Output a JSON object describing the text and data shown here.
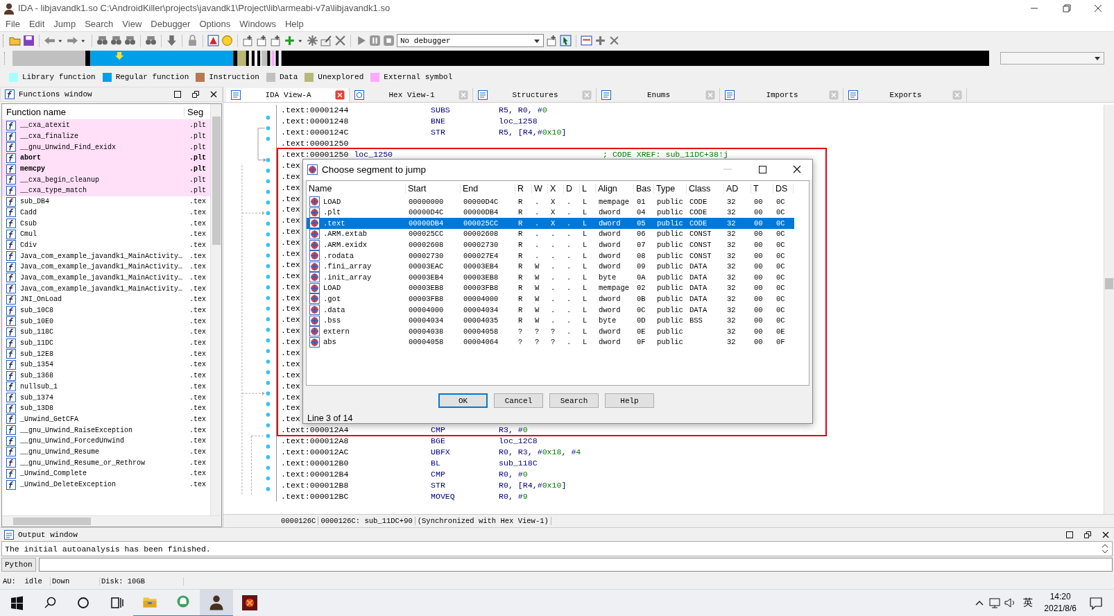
{
  "window": {
    "title": "IDA - libjavandk1.so C:\\AndroidKiller\\projects\\javandk1\\Project\\lib\\armeabi-v7a\\libjavandk1.so"
  },
  "menu": [
    "File",
    "Edit",
    "Jump",
    "Search",
    "View",
    "Debugger",
    "Options",
    "Windows",
    "Help"
  ],
  "toolbar": {
    "debugger_select": {
      "value": "No debugger"
    }
  },
  "legend": [
    {
      "label": "Library function",
      "color": "#a8ffff"
    },
    {
      "label": "Regular function",
      "color": "#00a0e8"
    },
    {
      "label": "Instruction",
      "color": "#b87850"
    },
    {
      "label": "Data",
      "color": "#c0c0c0"
    },
    {
      "label": "Unexplored",
      "color": "#b8b878"
    },
    {
      "label": "External symbol",
      "color": "#ffa8ff"
    }
  ],
  "functions_window": {
    "title": "Functions window",
    "columns": [
      "Function name",
      "Seg"
    ],
    "rows": [
      {
        "name": "__cxa_atexit",
        "segment": ".plt",
        "kind": "external",
        "bold": false
      },
      {
        "name": "__cxa_finalize",
        "segment": ".plt",
        "kind": "external",
        "bold": false
      },
      {
        "name": "__gnu_Unwind_Find_exidx",
        "segment": ".plt",
        "kind": "external",
        "bold": false
      },
      {
        "name": "abort",
        "segment": ".plt",
        "kind": "external",
        "bold": true
      },
      {
        "name": "memcpy",
        "segment": ".plt",
        "kind": "external",
        "bold": true
      },
      {
        "name": "__cxa_begin_cleanup",
        "segment": ".plt",
        "kind": "external",
        "bold": false
      },
      {
        "name": "__cxa_type_match",
        "segment": ".plt",
        "kind": "external",
        "bold": false
      },
      {
        "name": "sub_DB4",
        "segment": ".tex",
        "kind": "regular",
        "bold": false
      },
      {
        "name": "Cadd",
        "segment": ".tex",
        "kind": "regular",
        "bold": false
      },
      {
        "name": "Csub",
        "segment": ".tex",
        "kind": "regular",
        "bold": false
      },
      {
        "name": "Cmul",
        "segment": ".tex",
        "kind": "regular",
        "bold": false
      },
      {
        "name": "Cdiv",
        "segment": ".tex",
        "kind": "regular",
        "bold": false
      },
      {
        "name": "Java_com_example_javandk1_MainActivity…",
        "segment": ".tex",
        "kind": "regular",
        "bold": false
      },
      {
        "name": "Java_com_example_javandk1_MainActivity…",
        "segment": ".tex",
        "kind": "regular",
        "bold": false
      },
      {
        "name": "Java_com_example_javandk1_MainActivity…",
        "segment": ".tex",
        "kind": "regular",
        "bold": false
      },
      {
        "name": "Java_com_example_javandk1_MainActivity…",
        "segment": ".tex",
        "kind": "regular",
        "bold": false
      },
      {
        "name": "JNI_OnLoad",
        "segment": ".tex",
        "kind": "regular",
        "bold": false
      },
      {
        "name": "sub_10C8",
        "segment": ".tex",
        "kind": "regular",
        "bold": false
      },
      {
        "name": "sub_10E0",
        "segment": ".tex",
        "kind": "regular",
        "bold": false
      },
      {
        "name": "sub_118C",
        "segment": ".tex",
        "kind": "regular",
        "bold": false
      },
      {
        "name": "sub_11DC",
        "segment": ".tex",
        "kind": "regular",
        "bold": false
      },
      {
        "name": "sub_12E8",
        "segment": ".tex",
        "kind": "regular",
        "bold": false
      },
      {
        "name": "sub_1354",
        "segment": ".tex",
        "kind": "regular",
        "bold": false
      },
      {
        "name": "sub_1368",
        "segment": ".tex",
        "kind": "regular",
        "bold": false
      },
      {
        "name": "nullsub_1",
        "segment": ".tex",
        "kind": "regular",
        "bold": false
      },
      {
        "name": "sub_1374",
        "segment": ".tex",
        "kind": "regular",
        "bold": false
      },
      {
        "name": "sub_13D8",
        "segment": ".tex",
        "kind": "regular",
        "bold": false
      },
      {
        "name": "_Unwind_GetCFA",
        "segment": ".tex",
        "kind": "regular",
        "bold": false
      },
      {
        "name": "__gnu_Unwind_RaiseException",
        "segment": ".tex",
        "kind": "regular",
        "bold": false
      },
      {
        "name": "__gnu_Unwind_ForcedUnwind",
        "segment": ".tex",
        "kind": "regular",
        "bold": false
      },
      {
        "name": "__gnu_Unwind_Resume",
        "segment": ".tex",
        "kind": "regular",
        "bold": false
      },
      {
        "name": "__gnu_Unwind_Resume_or_Rethrow",
        "segment": ".tex",
        "kind": "regular",
        "bold": false
      },
      {
        "name": "_Unwind_Complete",
        "segment": ".tex",
        "kind": "regular",
        "bold": false
      },
      {
        "name": "_Unwind_DeleteException",
        "segment": ".tex",
        "kind": "regular",
        "bold": false
      }
    ]
  },
  "ida_view": {
    "tabs": [
      {
        "label": "IDA View-A",
        "selected": true
      },
      {
        "label": "Hex View-1",
        "selected": false
      },
      {
        "label": "Structures",
        "selected": false
      },
      {
        "label": "Enums",
        "selected": false
      },
      {
        "label": "Imports",
        "selected": false
      },
      {
        "label": "Exports",
        "selected": false
      }
    ],
    "lines": [
      {
        "address": ".text:00001244",
        "mnemonic": "SUBS",
        "operands": [
          {
            "text": "R5, R0, #",
            "kind": "reg"
          },
          {
            "text": "0",
            "kind": "num"
          }
        ]
      },
      {
        "address": ".text:00001248",
        "mnemonic": "BNE",
        "operands": [
          {
            "text": "loc_1258",
            "kind": "reg"
          }
        ]
      },
      {
        "address": ".text:0000124C",
        "mnemonic": "STR",
        "operands": [
          {
            "text": "R5, [R4,#",
            "kind": "reg"
          },
          {
            "text": "0x10",
            "kind": "num"
          },
          {
            "text": "]",
            "kind": "reg"
          }
        ]
      },
      {
        "address": ".text:00001250"
      },
      {
        "address": ".text:00001250",
        "label": "loc_1250",
        "comment": "; CODE XREF: sub_11DC+38↑j"
      },
      {
        "address": ".tex"
      },
      {
        "address": ".tex"
      },
      {
        "address": ".tex"
      },
      {
        "address": ".tex"
      },
      {
        "address": ".tex"
      },
      {
        "address": ".tex"
      },
      {
        "address": ".tex"
      },
      {
        "address": ".tex"
      },
      {
        "address": ".tex"
      },
      {
        "address": ".tex"
      },
      {
        "address": ".tex"
      },
      {
        "address": ".tex"
      },
      {
        "address": ".tex"
      },
      {
        "address": ".tex"
      },
      {
        "address": ".tex"
      },
      {
        "address": ".tex"
      },
      {
        "address": ".tex"
      },
      {
        "address": ".tex"
      },
      {
        "address": ".tex"
      },
      {
        "address": ".tex"
      },
      {
        "address": ".tex"
      },
      {
        "address": ".tex"
      },
      {
        "address": ".tex"
      },
      {
        "address": ".tex"
      },
      {
        "address": ".text:000012A4",
        "mnemonic": "CMP",
        "operands": [
          {
            "text": "R3, #",
            "kind": "reg"
          },
          {
            "text": "0",
            "kind": "num"
          }
        ]
      },
      {
        "address": ".text:000012A8",
        "mnemonic": "BGE",
        "operands": [
          {
            "text": "loc_12C8",
            "kind": "reg"
          }
        ]
      },
      {
        "address": ".text:000012AC",
        "mnemonic": "UBFX",
        "operands": [
          {
            "text": "R0, R3, #",
            "kind": "reg"
          },
          {
            "text": "0x18",
            "kind": "num"
          },
          {
            "text": ", #",
            "kind": "reg"
          },
          {
            "text": "4",
            "kind": "num"
          }
        ]
      },
      {
        "address": ".text:000012B0",
        "mnemonic": "BL",
        "operands": [
          {
            "text": "sub_118C",
            "kind": "reg"
          }
        ]
      },
      {
        "address": ".text:000012B4",
        "mnemonic": "CMP",
        "operands": [
          {
            "text": "R0, #",
            "kind": "reg"
          },
          {
            "text": "0",
            "kind": "num"
          }
        ]
      },
      {
        "address": ".text:000012B8",
        "mnemonic": "STR",
        "operands": [
          {
            "text": "R0, [R4,#",
            "kind": "reg"
          },
          {
            "text": "0x10",
            "kind": "num"
          },
          {
            "text": "]",
            "kind": "reg"
          }
        ]
      },
      {
        "address": ".text:000012BC",
        "mnemonic": "MOVEQ",
        "operands": [
          {
            "text": "R0, #",
            "kind": "reg"
          },
          {
            "text": "9",
            "kind": "num"
          }
        ]
      }
    ],
    "status": [
      "0000126C",
      "0000126C: sub_11DC+90",
      "(Synchronized with Hex View-1)"
    ]
  },
  "dialog": {
    "title": "Choose segment to jump",
    "columns": [
      "Name",
      "Start",
      "End",
      "R",
      "W",
      "X",
      "D",
      "L",
      "Align",
      "Bas",
      "Type",
      "Class",
      "AD",
      "T",
      "DS"
    ],
    "rows": [
      {
        "name": "LOAD",
        "start": "00000000",
        "end": "00000D4C",
        "r": "R",
        "w": ".",
        "x": "X",
        "d": ".",
        "l": "L",
        "align": "mempage",
        "base": "01",
        "type": "public",
        "class": "CODE",
        "ad": "32",
        "t": "00",
        "ds": "0C",
        "selected": false
      },
      {
        "name": ".plt",
        "start": "00000D4C",
        "end": "00000DB4",
        "r": "R",
        "w": ".",
        "x": "X",
        "d": ".",
        "l": "L",
        "align": "dword",
        "base": "04",
        "type": "public",
        "class": "CODE",
        "ad": "32",
        "t": "00",
        "ds": "0C",
        "selected": false
      },
      {
        "name": ".text",
        "start": "00000DB4",
        "end": "000025CC",
        "r": "R",
        "w": ".",
        "x": "X",
        "d": ".",
        "l": "L",
        "align": "dword",
        "base": "05",
        "type": "public",
        "class": "CODE",
        "ad": "32",
        "t": "00",
        "ds": "0C",
        "selected": true
      },
      {
        "name": ".ARM.extab",
        "start": "000025CC",
        "end": "00002608",
        "r": "R",
        "w": ".",
        "x": ".",
        "d": ".",
        "l": "L",
        "align": "dword",
        "base": "06",
        "type": "public",
        "class": "CONST",
        "ad": "32",
        "t": "00",
        "ds": "0C",
        "selected": false
      },
      {
        "name": ".ARM.exidx",
        "start": "00002608",
        "end": "00002730",
        "r": "R",
        "w": ".",
        "x": ".",
        "d": ".",
        "l": "L",
        "align": "dword",
        "base": "07",
        "type": "public",
        "class": "CONST",
        "ad": "32",
        "t": "00",
        "ds": "0C",
        "selected": false
      },
      {
        "name": ".rodata",
        "start": "00002730",
        "end": "000027E4",
        "r": "R",
        "w": ".",
        "x": ".",
        "d": ".",
        "l": "L",
        "align": "dword",
        "base": "08",
        "type": "public",
        "class": "CONST",
        "ad": "32",
        "t": "00",
        "ds": "0C",
        "selected": false
      },
      {
        "name": ".fini_array",
        "start": "00003EAC",
        "end": "00003EB4",
        "r": "R",
        "w": "W",
        "x": ".",
        "d": ".",
        "l": "L",
        "align": "dword",
        "base": "09",
        "type": "public",
        "class": "DATA",
        "ad": "32",
        "t": "00",
        "ds": "0C",
        "selected": false
      },
      {
        "name": ".init_array",
        "start": "00003EB4",
        "end": "00003EB8",
        "r": "R",
        "w": "W",
        "x": ".",
        "d": ".",
        "l": "L",
        "align": "byte",
        "base": "0A",
        "type": "public",
        "class": "DATA",
        "ad": "32",
        "t": "00",
        "ds": "0C",
        "selected": false
      },
      {
        "name": "LOAD",
        "start": "00003EB8",
        "end": "00003FB8",
        "r": "R",
        "w": "W",
        "x": ".",
        "d": ".",
        "l": "L",
        "align": "mempage",
        "base": "02",
        "type": "public",
        "class": "DATA",
        "ad": "32",
        "t": "00",
        "ds": "0C",
        "selected": false
      },
      {
        "name": ".got",
        "start": "00003FB8",
        "end": "00004000",
        "r": "R",
        "w": "W",
        "x": ".",
        "d": ".",
        "l": "L",
        "align": "dword",
        "base": "0B",
        "type": "public",
        "class": "DATA",
        "ad": "32",
        "t": "00",
        "ds": "0C",
        "selected": false
      },
      {
        "name": ".data",
        "start": "00004000",
        "end": "00004034",
        "r": "R",
        "w": "W",
        "x": ".",
        "d": ".",
        "l": "L",
        "align": "dword",
        "base": "0C",
        "type": "public",
        "class": "DATA",
        "ad": "32",
        "t": "00",
        "ds": "0C",
        "selected": false
      },
      {
        "name": ".bss",
        "start": "00004034",
        "end": "00004035",
        "r": "R",
        "w": "W",
        "x": ".",
        "d": ".",
        "l": "L",
        "align": "byte",
        "base": "0D",
        "type": "public",
        "class": "BSS",
        "ad": "32",
        "t": "00",
        "ds": "0C",
        "selected": false
      },
      {
        "name": "extern",
        "start": "00004038",
        "end": "00004058",
        "r": "?",
        "w": "?",
        "x": "?",
        "d": ".",
        "l": "L",
        "align": "dword",
        "base": "0E",
        "type": "public",
        "ad": "32",
        "t": "00",
        "ds": "0E",
        "selected": false
      },
      {
        "name": "abs",
        "start": "00004058",
        "end": "00004064",
        "r": "?",
        "w": "?",
        "x": "?",
        "d": ".",
        "l": "L",
        "align": "dword",
        "base": "0F",
        "type": "public",
        "ad": "32",
        "t": "00",
        "ds": "0F",
        "selected": false
      }
    ],
    "buttons": [
      {
        "label": "OK",
        "default": true
      },
      {
        "label": "Cancel",
        "default": false
      },
      {
        "label": "Search",
        "default": false
      },
      {
        "label": "Help",
        "default": false
      }
    ],
    "status": "Line 3 of 14"
  },
  "output_window": {
    "title": "Output window",
    "lines": [
      "The initial autoanalysis has been finished."
    ],
    "python_button": "Python"
  },
  "status_bar": [
    "AU:  idle",
    "Down",
    "Disk: 10GB"
  ],
  "taskbar": {
    "ime": "英",
    "time": "14:20",
    "date": "2021/8/6"
  }
}
